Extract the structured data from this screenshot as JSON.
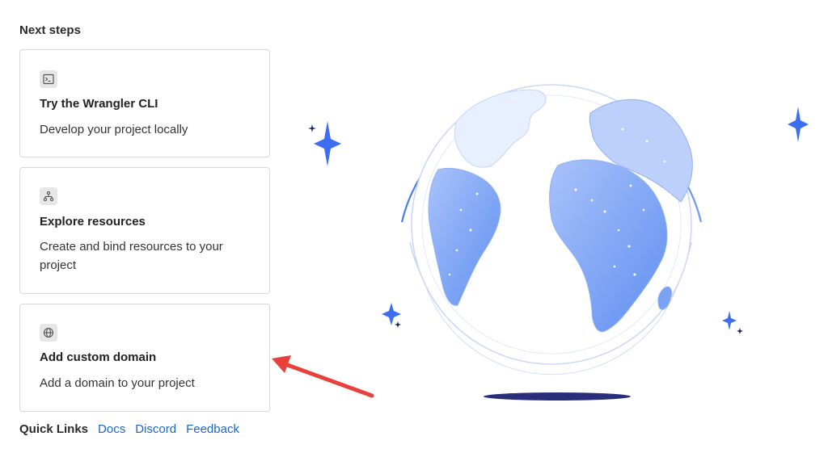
{
  "section": {
    "title": "Next steps"
  },
  "cards": [
    {
      "icon": "terminal-icon",
      "title": "Try the Wrangler CLI",
      "description": "Develop your project locally"
    },
    {
      "icon": "resources-icon",
      "title": "Explore resources",
      "description": "Create and bind resources to your project"
    },
    {
      "icon": "globe-icon",
      "title": "Add custom domain",
      "description": "Add a domain to your project"
    }
  ],
  "quick_links": {
    "label": "Quick Links",
    "links": [
      "Docs",
      "Discord",
      "Feedback"
    ]
  },
  "colors": {
    "link": "#1a66c9",
    "card_border": "#d9d9d9",
    "globe_blue": "#5b8bf0",
    "sparkle_blue": "#3b6ef0",
    "arrow_red": "#e8413c"
  }
}
